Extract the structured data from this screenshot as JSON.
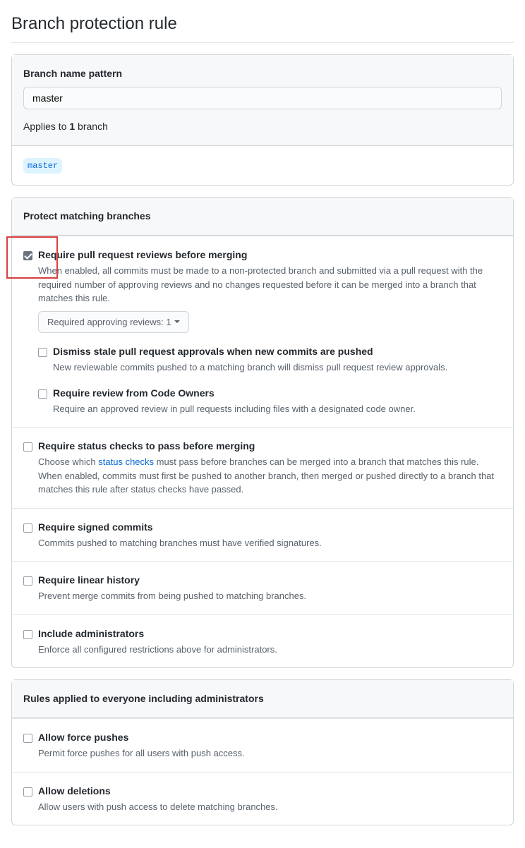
{
  "page_title": "Branch protection rule",
  "pattern": {
    "label": "Branch name pattern",
    "value": "master",
    "applies_prefix": "Applies to ",
    "applies_count": "1",
    "applies_suffix": " branch",
    "chip": "master"
  },
  "protect_section_title": "Protect matching branches",
  "rules": {
    "require_pr": {
      "label": "Require pull request reviews before merging",
      "desc": "When enabled, all commits must be made to a non-protected branch and submitted via a pull request with the required number of approving reviews and no changes requested before it can be merged into a branch that matches this rule.",
      "checked": true,
      "dropdown_label": "Required approving reviews: 1",
      "sub": {
        "dismiss": {
          "label": "Dismiss stale pull request approvals when new commits are pushed",
          "desc": "New reviewable commits pushed to a matching branch will dismiss pull request review approvals."
        },
        "codeowners": {
          "label": "Require review from Code Owners",
          "desc": "Require an approved review in pull requests including files with a designated code owner."
        }
      }
    },
    "status_checks": {
      "label": "Require status checks to pass before merging",
      "desc_before": "Choose which ",
      "desc_link": "status checks",
      "desc_after": " must pass before branches can be merged into a branch that matches this rule. When enabled, commits must first be pushed to another branch, then merged or pushed directly to a branch that matches this rule after status checks have passed."
    },
    "signed": {
      "label": "Require signed commits",
      "desc": "Commits pushed to matching branches must have verified signatures."
    },
    "linear": {
      "label": "Require linear history",
      "desc": "Prevent merge commits from being pushed to matching branches."
    },
    "admins": {
      "label": "Include administrators",
      "desc": "Enforce all configured restrictions above for administrators."
    }
  },
  "everyone_section_title": "Rules applied to everyone including administrators",
  "force": {
    "label": "Allow force pushes",
    "desc": "Permit force pushes for all users with push access."
  },
  "delete": {
    "label": "Allow deletions",
    "desc": "Allow users with push access to delete matching branches."
  }
}
